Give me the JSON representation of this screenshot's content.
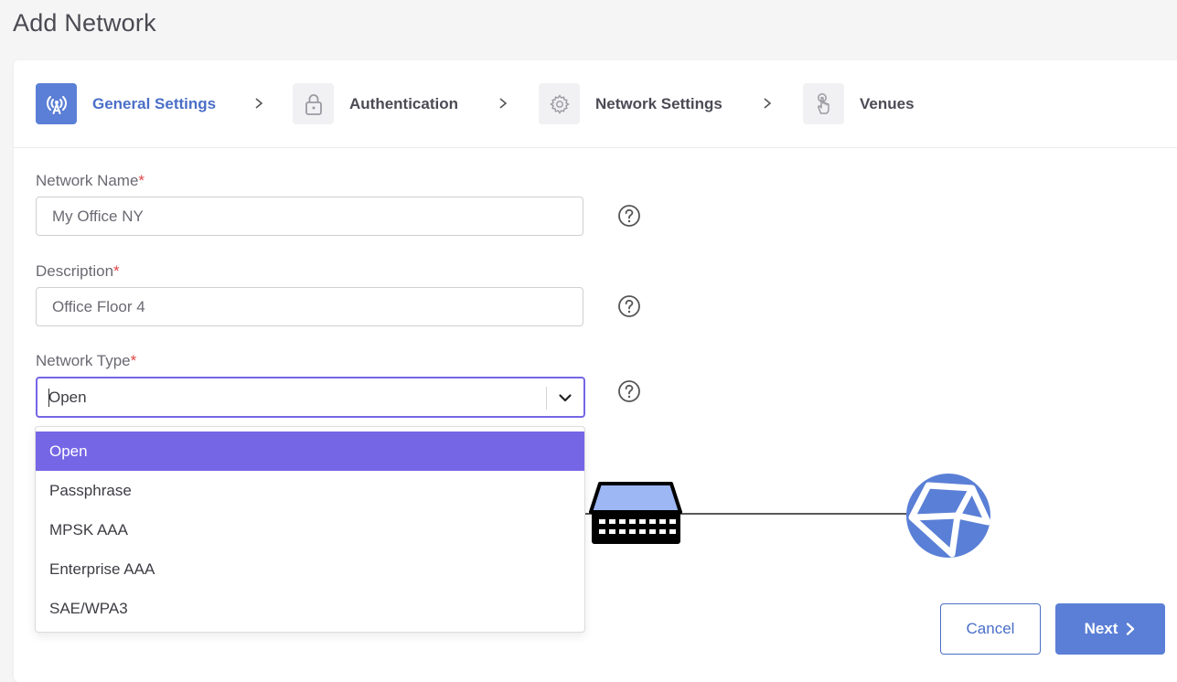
{
  "page": {
    "title": "Add Network"
  },
  "stepper": {
    "steps": [
      {
        "label": "General Settings",
        "icon": "antenna-icon",
        "active": true
      },
      {
        "label": "Authentication",
        "icon": "lock-icon",
        "active": false
      },
      {
        "label": "Network Settings",
        "icon": "gear-icon",
        "active": false
      },
      {
        "label": "Venues",
        "icon": "hand-pointer-icon",
        "active": false
      }
    ]
  },
  "form": {
    "network_name": {
      "label": "Network Name",
      "required_mark": "*",
      "value": "My Office NY"
    },
    "description": {
      "label": "Description",
      "required_mark": "*",
      "value": "Office Floor 4"
    },
    "network_type": {
      "label": "Network Type",
      "required_mark": "*",
      "value": "Open",
      "options": [
        "Open",
        "Passphrase",
        "MPSK AAA",
        "Enterprise AAA",
        "SAE/WPA3"
      ],
      "selected_option": "Open"
    }
  },
  "actions": {
    "cancel_label": "Cancel",
    "next_label": "Next"
  },
  "colors": {
    "accent": "#5b7fd6",
    "select_highlight": "#7566e6",
    "required": "#e04646",
    "globe": "#5b7fd6"
  }
}
